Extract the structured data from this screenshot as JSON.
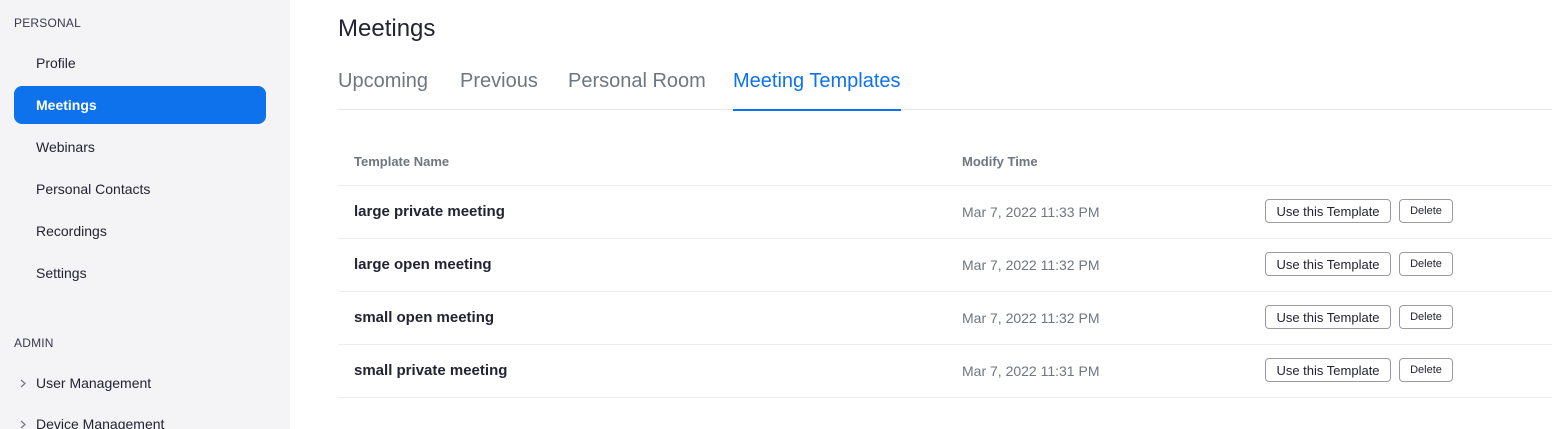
{
  "sidebar": {
    "personal_label": "PERSONAL",
    "personal_items": [
      {
        "label": "Profile"
      },
      {
        "label": "Meetings"
      },
      {
        "label": "Webinars"
      },
      {
        "label": "Personal Contacts"
      },
      {
        "label": "Recordings"
      },
      {
        "label": "Settings"
      }
    ],
    "active_item": "Meetings",
    "admin_label": "ADMIN",
    "admin_items": [
      {
        "label": "User Management",
        "icon": "chevron-right-icon"
      },
      {
        "label": "Device Management",
        "icon": "chevron-right-icon"
      }
    ]
  },
  "main": {
    "title": "Meetings",
    "tabs": [
      {
        "label": "Upcoming"
      },
      {
        "label": "Previous"
      },
      {
        "label": "Personal Room"
      },
      {
        "label": "Meeting Templates"
      }
    ],
    "active_tab": "Meeting Templates",
    "table": {
      "headers": {
        "name": "Template Name",
        "time": "Modify Time"
      },
      "use_label": "Use this Template",
      "delete_label": "Delete",
      "rows": [
        {
          "name": "large private meeting",
          "time": "Mar 7, 2022 11:33 PM"
        },
        {
          "name": "large open meeting",
          "time": "Mar 7, 2022 11:32 PM"
        },
        {
          "name": "small open meeting",
          "time": "Mar 7, 2022 11:32 PM"
        },
        {
          "name": "small private meeting",
          "time": "Mar 7, 2022 11:31 PM"
        }
      ]
    }
  },
  "colors": {
    "accent": "#0e72ed",
    "sidebar_bg": "#f4f4f6",
    "muted_text": "#6e7680"
  }
}
